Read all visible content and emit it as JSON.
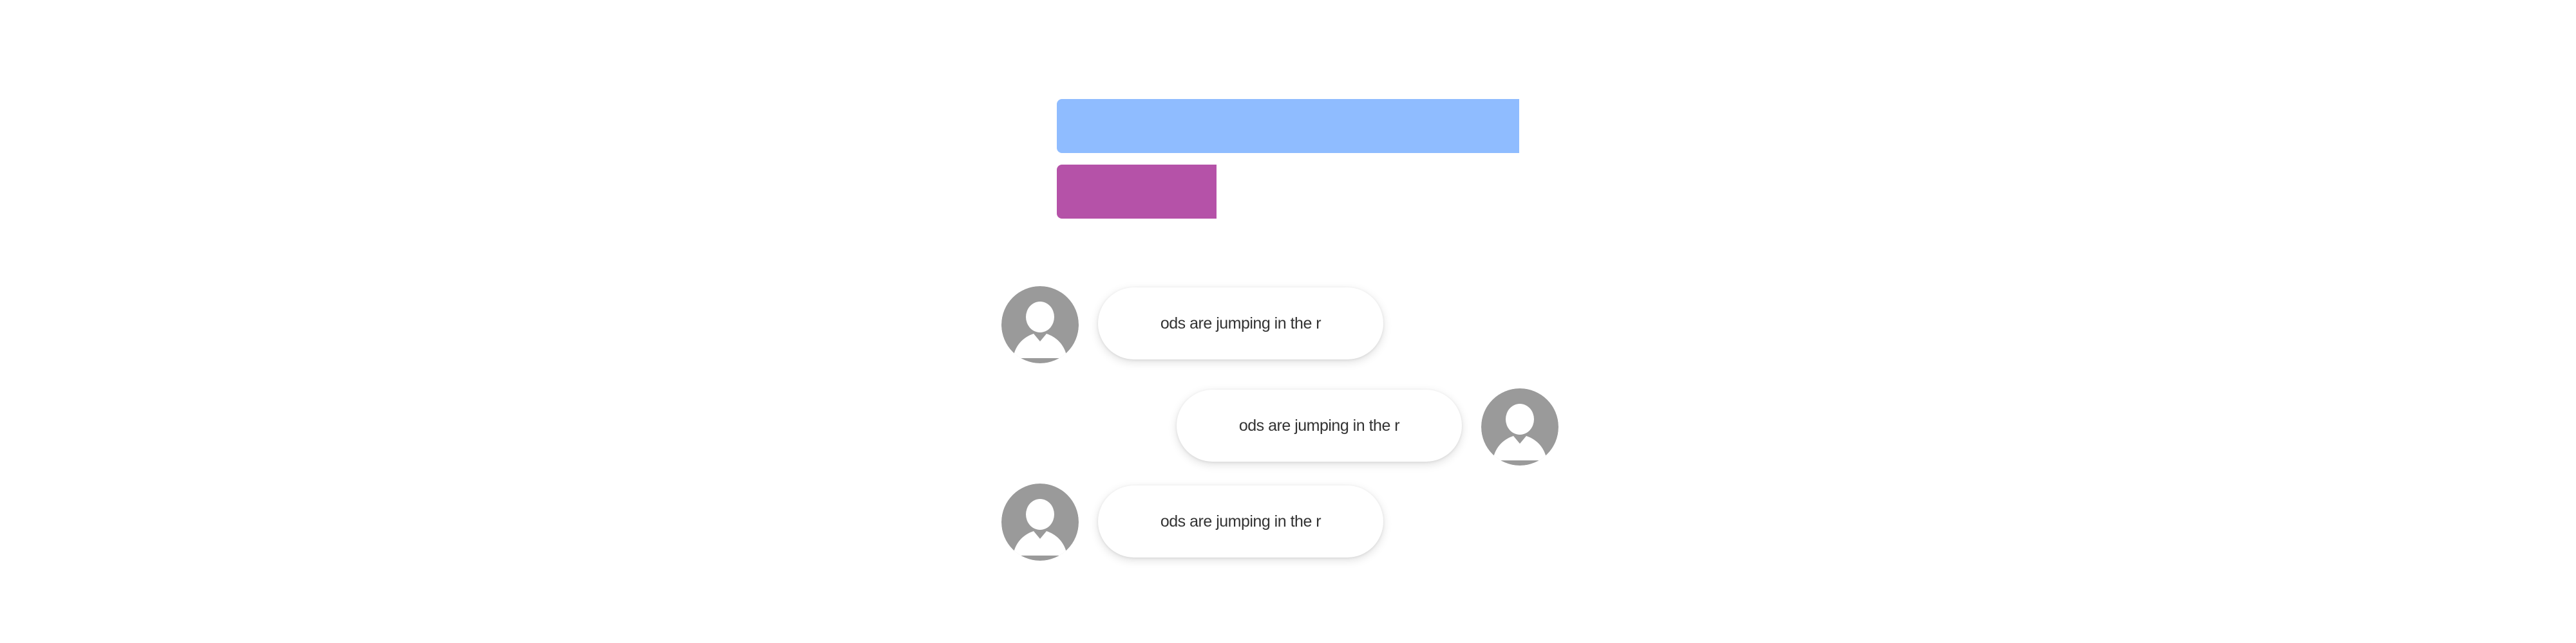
{
  "bars": {
    "blue_color": "#8fbcff",
    "purple_color": "#b552a8"
  },
  "avatar": {
    "icon": "user-silhouette-icon",
    "color": "#9a9a9a"
  },
  "messages": [
    {
      "side": "left",
      "text": "ods are jumping in the r"
    },
    {
      "side": "right",
      "text": "ods are jumping in the r"
    },
    {
      "side": "left",
      "text": "ods are jumping in the r"
    }
  ]
}
